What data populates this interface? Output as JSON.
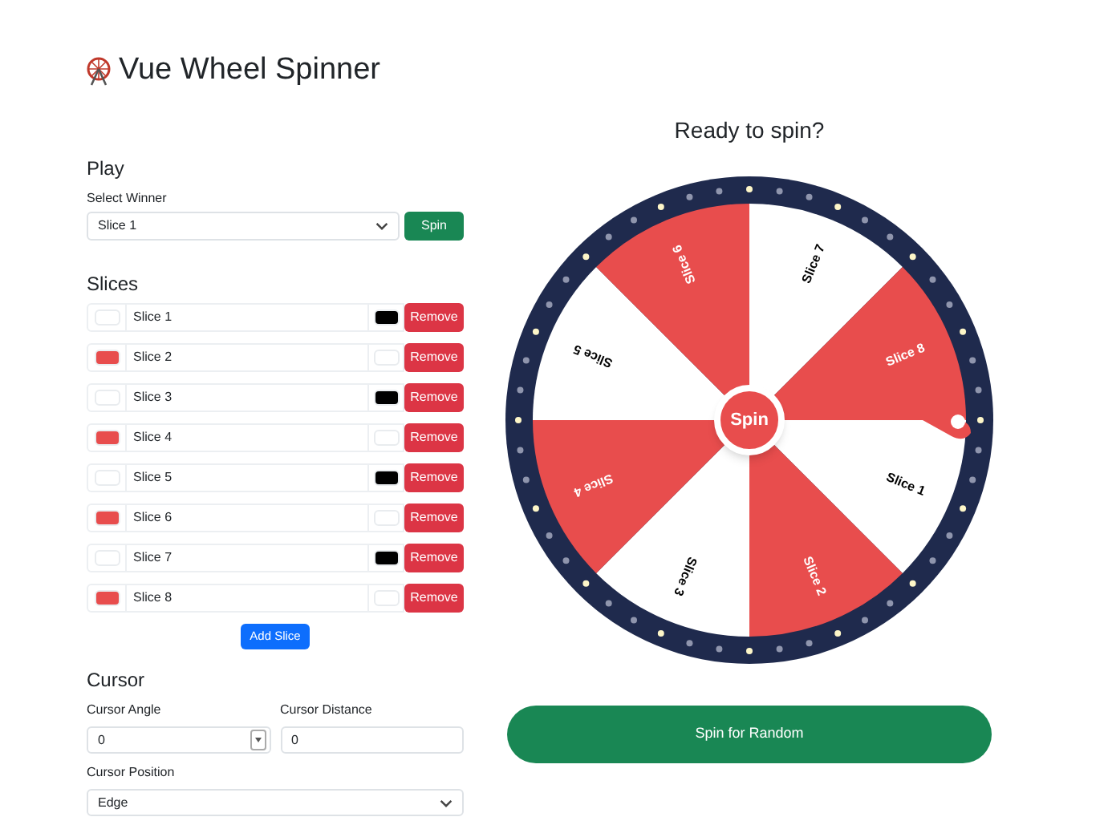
{
  "title": "Vue Wheel Spinner",
  "play": {
    "heading": "Play",
    "select_label": "Select Winner",
    "select_value": "Slice 1",
    "spin_button": "Spin"
  },
  "slices_section": {
    "heading": "Slices",
    "add_button": "Add Slice",
    "slices": [
      {
        "text": "Slice 1",
        "fill": {
          "color": "#ffffff"
        },
        "ink": {
          "color": "#000000"
        },
        "remove": "Remove"
      },
      {
        "text": "Slice 2",
        "fill": {
          "color": "#e84d4d"
        },
        "ink": {
          "color": "#ffffff"
        },
        "remove": "Remove"
      },
      {
        "text": "Slice 3",
        "fill": {
          "color": "#ffffff"
        },
        "ink": {
          "color": "#000000"
        },
        "remove": "Remove"
      },
      {
        "text": "Slice 4",
        "fill": {
          "color": "#e84d4d"
        },
        "ink": {
          "color": "#ffffff"
        },
        "remove": "Remove"
      },
      {
        "text": "Slice 5",
        "fill": {
          "color": "#ffffff"
        },
        "ink": {
          "color": "#000000"
        },
        "remove": "Remove"
      },
      {
        "text": "Slice 6",
        "fill": {
          "color": "#e84d4d"
        },
        "ink": {
          "color": "#ffffff"
        },
        "remove": "Remove"
      },
      {
        "text": "Slice 7",
        "fill": {
          "color": "#ffffff"
        },
        "ink": {
          "color": "#000000"
        },
        "remove": "Remove"
      },
      {
        "text": "Slice 8",
        "fill": {
          "color": "#e84d4d"
        },
        "ink": {
          "color": "#ffffff"
        },
        "remove": "Remove"
      }
    ]
  },
  "cursor": {
    "heading": "Cursor",
    "angle_label": "Cursor Angle",
    "angle_value": "0",
    "distance_label": "Cursor Distance",
    "distance_value": "0",
    "position_label": "Cursor Position",
    "position_value": "Edge"
  },
  "wheel": {
    "heading": "Ready to spin?",
    "center_button": "Spin",
    "spin_random_button": "Spin for Random",
    "segments": [
      {
        "label": "Slice 1",
        "color": "#ffffff",
        "ink": {
          "color": "#000000"
        }
      },
      {
        "label": "Slice 2",
        "color": "#e84d4d",
        "ink": {
          "color": "#ffffff"
        }
      },
      {
        "label": "Slice 3",
        "color": "#ffffff",
        "ink": {
          "color": "#000000"
        }
      },
      {
        "label": "Slice 4",
        "color": "#e84d4d",
        "ink": {
          "color": "#ffffff"
        }
      },
      {
        "label": "Slice 5",
        "color": "#ffffff",
        "ink": {
          "color": "#000000"
        }
      },
      {
        "label": "Slice 6",
        "color": "#e84d4d",
        "ink": {
          "color": "#ffffff"
        }
      },
      {
        "label": "Slice 7",
        "color": "#ffffff",
        "ink": {
          "color": "#000000"
        }
      },
      {
        "label": "Slice 8",
        "color": "#e84d4d",
        "ink": {
          "color": "#ffffff"
        }
      }
    ]
  }
}
